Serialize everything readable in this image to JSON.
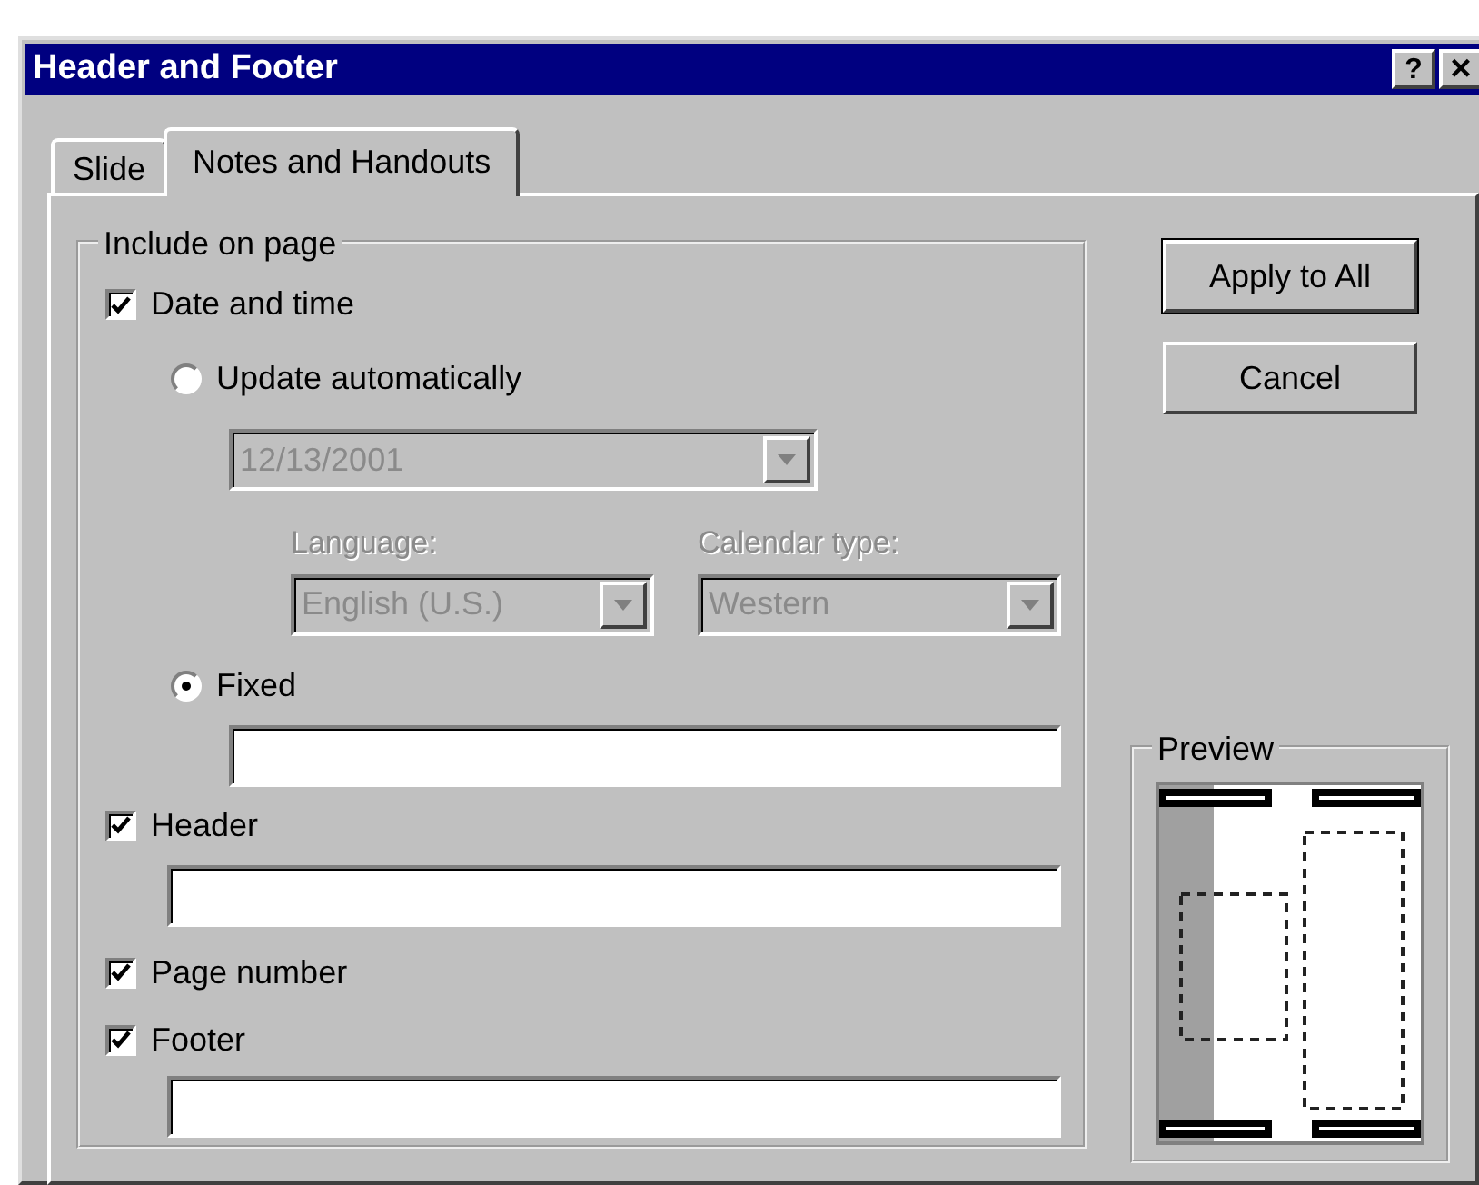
{
  "window": {
    "title": "Header and Footer",
    "title_buttons": [
      {
        "kind": "help",
        "label": "?"
      },
      {
        "kind": "close",
        "label": "×"
      }
    ]
  },
  "tabs": [
    {
      "label": "Slide",
      "selected": false
    },
    {
      "label": "Notes and Handouts",
      "selected": true
    }
  ],
  "include_group": {
    "legend": "Include on page",
    "date_time": {
      "label": "Date and time",
      "checked": true
    },
    "update_automatically": {
      "label": "Update automatically",
      "selected": false
    },
    "date_format": {
      "value": "12/13/2001",
      "disabled": true
    },
    "language": {
      "label": "Language:",
      "value": "English (U.S.)",
      "disabled": true
    },
    "calendar_type": {
      "label": "Calendar type:",
      "value": "Western",
      "disabled": true
    },
    "fixed": {
      "label": "Fixed",
      "selected": true
    },
    "header": {
      "label": "Header",
      "checked": true
    },
    "page_number": {
      "label": "Page number",
      "checked": true
    },
    "footer": {
      "label": "Footer",
      "checked": true
    }
  },
  "buttons": [
    {
      "label": "Apply to All",
      "default": true
    },
    {
      "label": "Cancel",
      "default": false
    }
  ],
  "preview": {
    "legend": "Preview"
  }
}
